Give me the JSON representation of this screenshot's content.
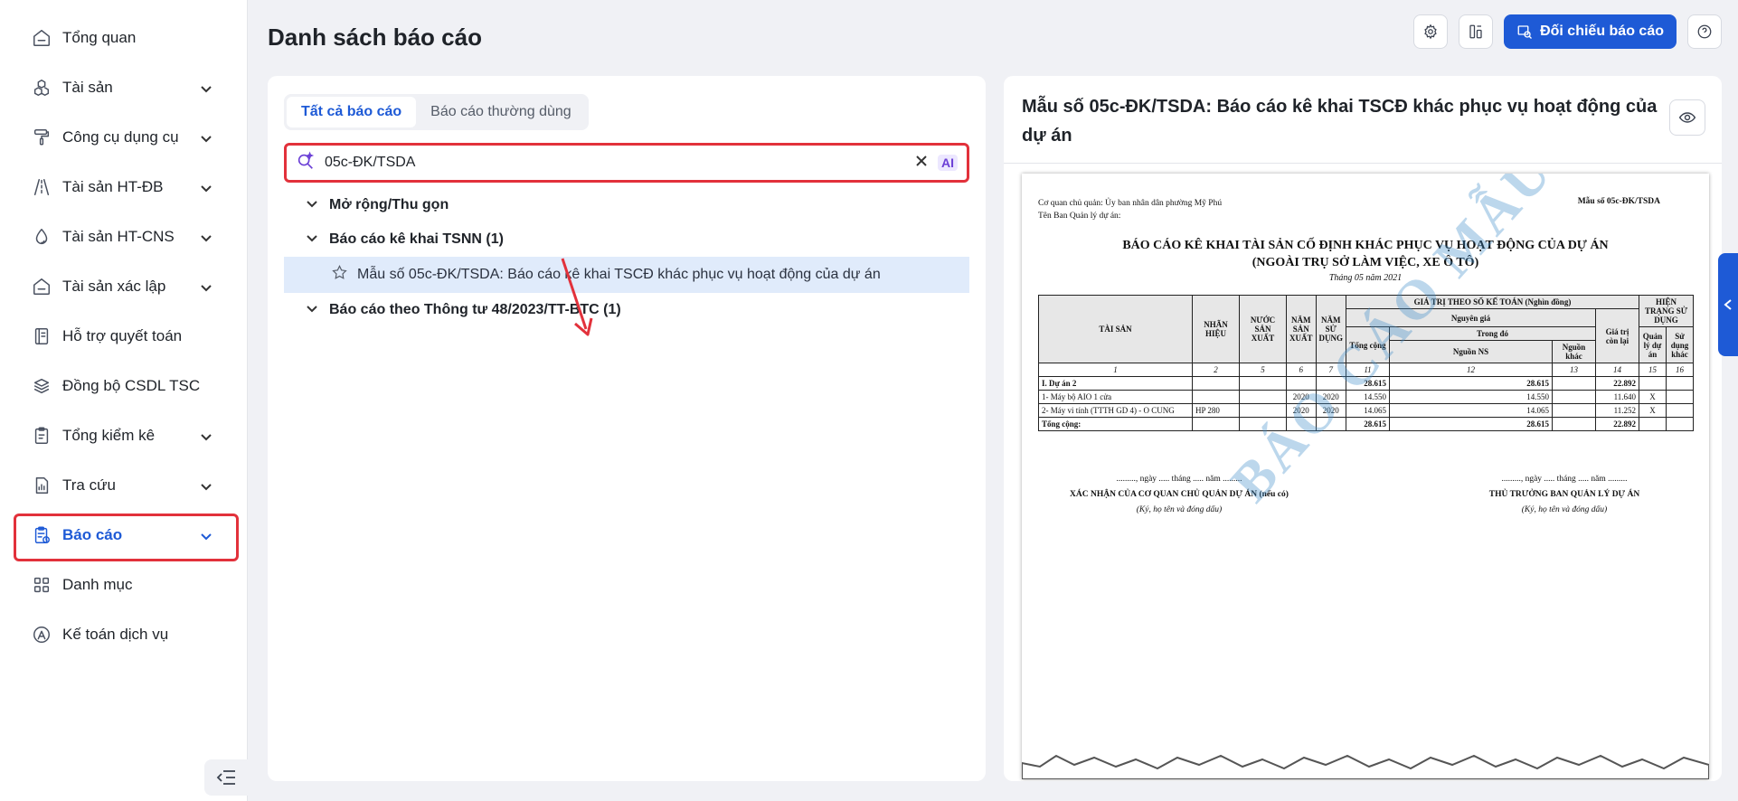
{
  "sidebar": {
    "items": [
      {
        "label": "Tổng quan",
        "icon": "home-icon",
        "expandable": false
      },
      {
        "label": "Tài sản",
        "icon": "boxes-icon",
        "expandable": true
      },
      {
        "label": "Công cụ dụng cụ",
        "icon": "paint-roller-icon",
        "expandable": true
      },
      {
        "label": "Tài sản HT-ĐB",
        "icon": "road-icon",
        "expandable": true
      },
      {
        "label": "Tài sản HT-CNS",
        "icon": "water-drop-icon",
        "expandable": true
      },
      {
        "label": "Tài sản xác lập",
        "icon": "home-icon",
        "expandable": true
      },
      {
        "label": "Hỗ trợ quyết toán",
        "icon": "book-icon",
        "expandable": false
      },
      {
        "label": "Đồng bộ CSDL TSC",
        "icon": "layers-sync-icon",
        "expandable": false
      },
      {
        "label": "Tổng kiểm kê",
        "icon": "clipboard-icon",
        "expandable": true
      },
      {
        "label": "Tra cứu",
        "icon": "chart-doc-icon",
        "expandable": true
      },
      {
        "label": "Báo cáo",
        "icon": "report-icon",
        "expandable": true,
        "active": true
      },
      {
        "label": "Danh mục",
        "icon": "grid-icon",
        "expandable": false
      },
      {
        "label": "Kế toán dịch vụ",
        "icon": "accounting-icon",
        "expandable": false
      }
    ]
  },
  "header": {
    "title": "Danh sách báo cáo",
    "compare_button": "Đối chiếu báo cáo"
  },
  "left_panel": {
    "tabs": [
      "Tất cả báo cáo",
      "Báo cáo thường dùng"
    ],
    "search_value": "05c-ĐK/TSDA",
    "ai_label": "AI",
    "tree": {
      "toggle_all": "Mở rộng/Thu gọn",
      "group1": "Báo cáo kê khai TSNN (1)",
      "group1_item": "Mẫu số 05c-ĐK/TSDA: Báo cáo kê khai TSCĐ khác phục vụ hoạt động của dự án",
      "group2": "Báo cáo theo Thông tư 48/2023/TT-BTC (1)"
    }
  },
  "preview": {
    "title": "Mẫu số 05c-ĐK/TSDA: Báo cáo kê khai TSCĐ khác phục vụ hoạt động của dự án",
    "paper": {
      "agency_line": "Cơ quan chủ quản: Ủy ban nhân dân phường Mỹ Phú",
      "board_line": "Tên Ban Quản lý dự án:",
      "form_code": "Mẫu số 05c-ĐK/TSDA",
      "title_line1": "BÁO CÁO KÊ KHAI TÀI SẢN CỐ ĐỊNH KHÁC PHỤC VỤ HOẠT ĐỘNG CỦA DỰ ÁN",
      "title_line2": "(NGOÀI TRỤ SỞ LÀM VIỆC, XE Ô TÔ)",
      "month": "Tháng 05 năm 2021",
      "headers": {
        "asset": "TÀI SẢN",
        "brand": "NHÃN HIỆU",
        "country": "NƯỚC SẢN XUẤT",
        "year_made": "NĂM SẢN XUẤT",
        "year_used": "NĂM SỬ DỤNG",
        "book_value": "GIÁ TRỊ THEO SỔ KẾ TOÁN (Nghìn đồng)",
        "original": "Nguyên giá",
        "total": "Tổng cộng",
        "of_which": "Trong đó",
        "budget": "Nguồn NS",
        "other": "Nguồn khác",
        "remaining": "Giá trị còn lại",
        "status": "HIỆN TRẠNG SỬ DỤNG",
        "managed": "Quản lý dự án",
        "other_use": "Sử dụng khác"
      },
      "col_numbers": [
        "1",
        "2",
        "5",
        "6",
        "7",
        "11",
        "12",
        "13",
        "14",
        "15",
        "16"
      ],
      "rows": [
        {
          "asset": "I. Dự án 2",
          "brand": "",
          "country": "",
          "made": "",
          "used": "",
          "total": "28.615",
          "budget": "28.615",
          "other": "",
          "remaining": "22.892",
          "managed": "",
          "other_use": "",
          "bold": true
        },
        {
          "asset": "1- Máy bộ AIO 1 cửa",
          "brand": "",
          "country": "",
          "made": "2020",
          "used": "2020",
          "total": "14.550",
          "budget": "14.550",
          "other": "",
          "remaining": "11.640",
          "managed": "X",
          "other_use": "",
          "bold": false
        },
        {
          "asset": "2- Máy vi tính (TTTH GD 4) - O CUNG",
          "brand": "HP 280",
          "country": "",
          "made": "2020",
          "used": "2020",
          "total": "14.065",
          "budget": "14.065",
          "other": "",
          "remaining": "11.252",
          "managed": "X",
          "other_use": "",
          "bold": false
        },
        {
          "asset": "Tổng cộng:",
          "brand": "",
          "country": "",
          "made": "",
          "used": "",
          "total": "28.615",
          "budget": "28.615",
          "other": "",
          "remaining": "22.892",
          "managed": "",
          "other_use": "",
          "bold": true
        }
      ],
      "sign_date": "........., ngày ..... tháng ..... năm .........",
      "sign_left_title": "XÁC NHẬN CỦA CƠ QUAN CHỦ QUẢN DỰ ÁN (nếu có)",
      "sign_left_note": "(Ký, họ tên và đóng dấu)",
      "sign_right_title": "THỦ TRƯỞNG BAN QUẢN LÝ DỰ ÁN",
      "sign_right_note": "(Ký, họ tên và đóng dấu)",
      "watermark": "BÁO CÁO MẪU"
    }
  },
  "colors": {
    "primary": "#1e5ad6",
    "highlight_border": "#e2313b",
    "selected_row": "#e0ebfb",
    "ai_accent": "#6b3fd6"
  }
}
